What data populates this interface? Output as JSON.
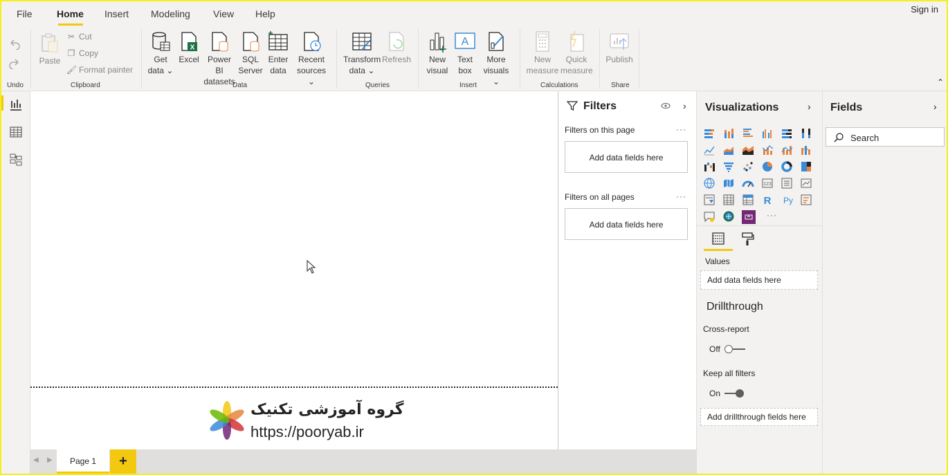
{
  "menu": {
    "items": [
      "File",
      "Home",
      "Insert",
      "Modeling",
      "View",
      "Help"
    ],
    "active": "Home",
    "signin": "Sign in"
  },
  "ribbon": {
    "undo": {
      "label": "Undo"
    },
    "clipboard": {
      "label": "Clipboard",
      "paste": "Paste",
      "cut": "Cut",
      "copy": "Copy",
      "format_painter": "Format painter"
    },
    "data": {
      "label": "Data",
      "get_data": [
        "Get",
        "data"
      ],
      "excel": "Excel",
      "pbi": [
        "Power BI",
        "datasets"
      ],
      "sql": [
        "SQL",
        "Server"
      ],
      "enter": [
        "Enter",
        "data"
      ],
      "recent": [
        "Recent",
        "sources"
      ]
    },
    "queries": {
      "label": "Queries",
      "transform": [
        "Transform",
        "data"
      ],
      "refresh": "Refresh"
    },
    "insert": {
      "label": "Insert",
      "new_visual": [
        "New",
        "visual"
      ],
      "text_box": [
        "Text",
        "box"
      ],
      "more_visuals": [
        "More",
        "visuals"
      ]
    },
    "calculations": {
      "label": "Calculations",
      "new_measure": [
        "New",
        "measure"
      ],
      "quick_measure": [
        "Quick",
        "measure"
      ]
    },
    "share": {
      "label": "Share",
      "publish": "Publish"
    }
  },
  "canvas": {
    "logo_fa": "گروه آموزشی تکنیک",
    "logo_url": "https://pooryab.ir"
  },
  "pages": {
    "tabs": [
      "Page 1"
    ],
    "add": "+"
  },
  "filters": {
    "title": "Filters",
    "on_this_page": "Filters on this page",
    "on_all_pages": "Filters on all pages",
    "add_fields": "Add data fields here",
    "more": "···"
  },
  "visualizations": {
    "title": "Visualizations",
    "values_label": "Values",
    "add_fields": "Add data fields here",
    "drillthrough": "Drillthrough",
    "cross_report": "Cross-report",
    "cross_report_state": "Off",
    "keep_filters": "Keep all filters",
    "keep_filters_state": "On",
    "add_drill": "Add drillthrough fields here",
    "more": "···",
    "r_label": "R",
    "py_label": "Py"
  },
  "fields": {
    "title": "Fields",
    "search_placeholder": "Search"
  },
  "colors": {
    "accent": "#f2c811",
    "frame": "#f4f01c",
    "icon_blue": "#3b8ad9",
    "icon_orange": "#e8853d",
    "excel_green": "#1e7145",
    "power_apps": "#742774"
  }
}
